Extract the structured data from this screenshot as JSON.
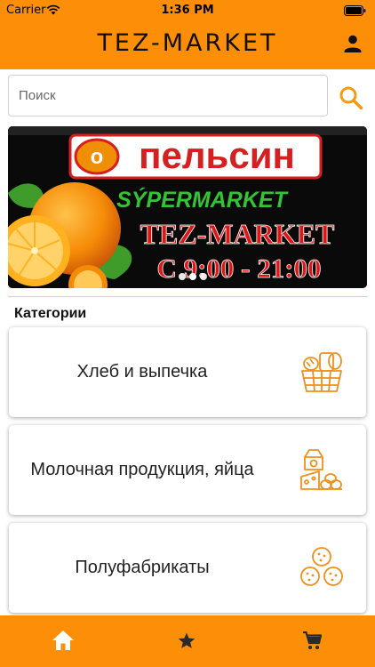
{
  "status_bar": {
    "carrier": "Carrier",
    "time": "1:36 PM"
  },
  "app": {
    "title": "TEZ-MARKET",
    "accent_color": "#fc8f07"
  },
  "search": {
    "placeholder": "Поиск",
    "value": ""
  },
  "banner": {
    "logo_text": "пельсин",
    "subtitle": "SÝPERMARKET",
    "store_name": "TEZ-MARKET",
    "hours": "С 9:00 - 21:00",
    "page_count": 3,
    "active_page": 1
  },
  "categories": {
    "title": "Категории",
    "items": [
      {
        "label": "Хлеб и выпечка",
        "icon": "bread-basket-icon"
      },
      {
        "label": "Молочная продукция, яйца",
        "icon": "dairy-eggs-icon"
      },
      {
        "label": "Полуфабрикаты",
        "icon": "semi-finished-icon"
      }
    ]
  },
  "tabbar": {
    "tabs": [
      {
        "name": "home",
        "icon": "home-icon",
        "active": true
      },
      {
        "name": "favorites",
        "icon": "star-icon",
        "active": false
      },
      {
        "name": "cart",
        "icon": "cart-icon",
        "active": false
      }
    ]
  }
}
